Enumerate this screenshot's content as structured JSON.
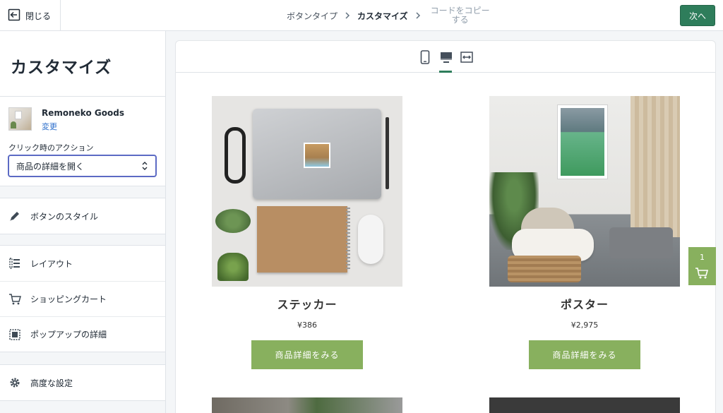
{
  "topbar": {
    "close_label": "閉じる",
    "steps": [
      "ボタンタイプ",
      "カスタマイズ",
      "コードをコピー",
      "する"
    ],
    "next_label": "次へ"
  },
  "sidebar": {
    "title": "カスタマイズ",
    "product": {
      "name": "Remoneko Goods",
      "change_label": "変更"
    },
    "action_label": "クリック時のアクション",
    "action_value": "商品の詳細を開く",
    "items": [
      {
        "label": "ボタンのスタイル",
        "icon": "paint-brush-icon"
      },
      {
        "label": "レイアウト",
        "icon": "layout-list-icon"
      },
      {
        "label": "ショッピングカート",
        "icon": "cart-icon"
      },
      {
        "label": "ポップアップの詳細",
        "icon": "popup-icon"
      },
      {
        "label": "高度な設定",
        "icon": "gear-icon"
      }
    ]
  },
  "preview": {
    "devices": [
      "mobile-icon",
      "desktop-icon",
      "fullwidth-icon"
    ],
    "active_device": "desktop-icon",
    "products": [
      {
        "title": "ステッカー",
        "price": "¥386",
        "button": "商品詳細をみる"
      },
      {
        "title": "ポスター",
        "price": "¥2,975",
        "button": "商品詳細をみる"
      }
    ]
  },
  "cart": {
    "count": "1"
  },
  "colors": {
    "primary": "#2e7d5b",
    "buy_button": "#88b05e",
    "select_focus": "#5c6ac4",
    "link": "#2c6ecb"
  }
}
